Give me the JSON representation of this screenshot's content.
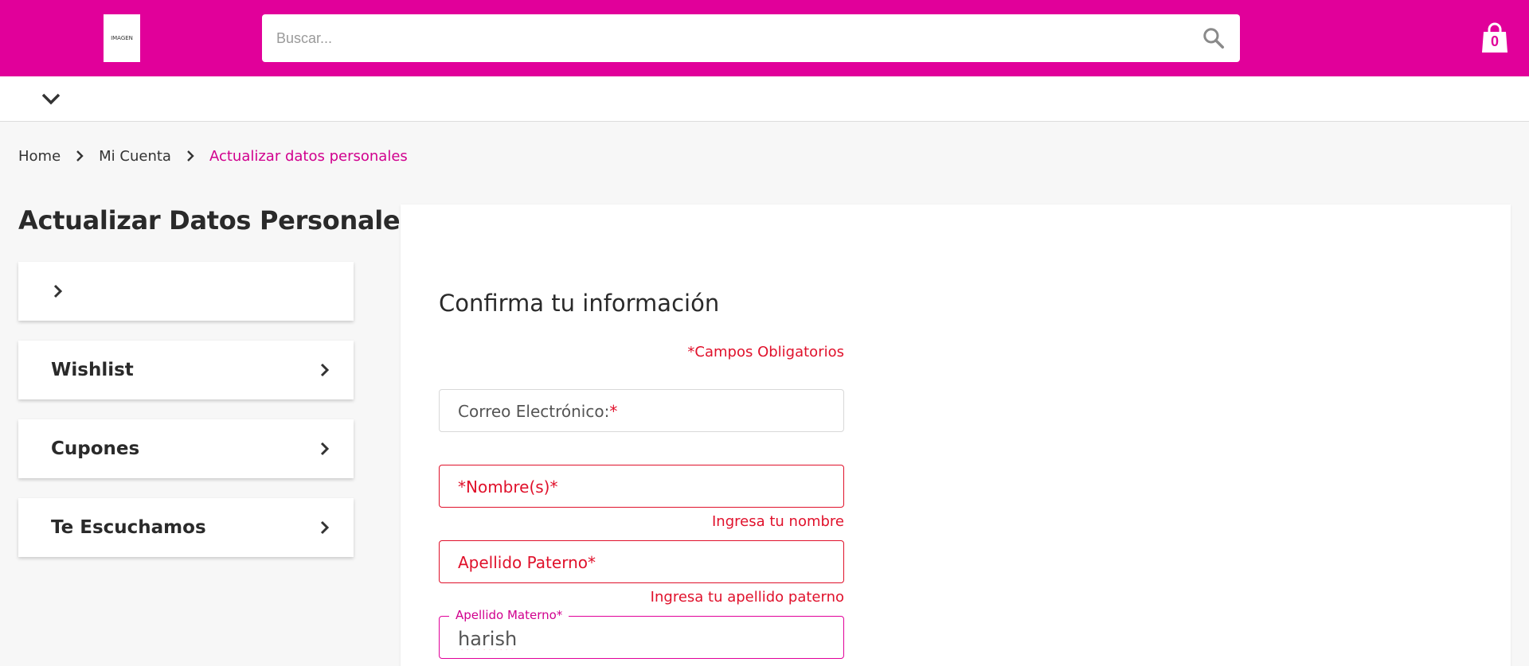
{
  "header": {
    "logo_text": "IMAGEN",
    "search_placeholder": "Buscar...",
    "cart_count": "0"
  },
  "breadcrumb": {
    "items": [
      "Home",
      "Mi Cuenta",
      "Actualizar datos personales"
    ]
  },
  "sidebar": {
    "title": "Actualizar Datos Personales",
    "items": [
      {
        "label": ""
      },
      {
        "label": "Wishlist"
      },
      {
        "label": "Cupones"
      },
      {
        "label": "Te Escuchamos"
      }
    ]
  },
  "form": {
    "title": "Confirma tu información",
    "required_note": "*Campos Obligatorios",
    "email": {
      "label": "Correo Electrónico:",
      "required_mark": "*"
    },
    "nombre": {
      "label": "*Nombre(s)*",
      "error": "Ingresa tu nombre"
    },
    "apellido_paterno": {
      "label": "Apellido Paterno*",
      "error": "Ingresa tu apellido paterno"
    },
    "apellido_materno": {
      "label": "Apellido Materno*",
      "value": "harish"
    }
  },
  "colors": {
    "brand": "#e1009a",
    "error": "#e0112b",
    "breadcrumb_active": "#d1008e"
  }
}
